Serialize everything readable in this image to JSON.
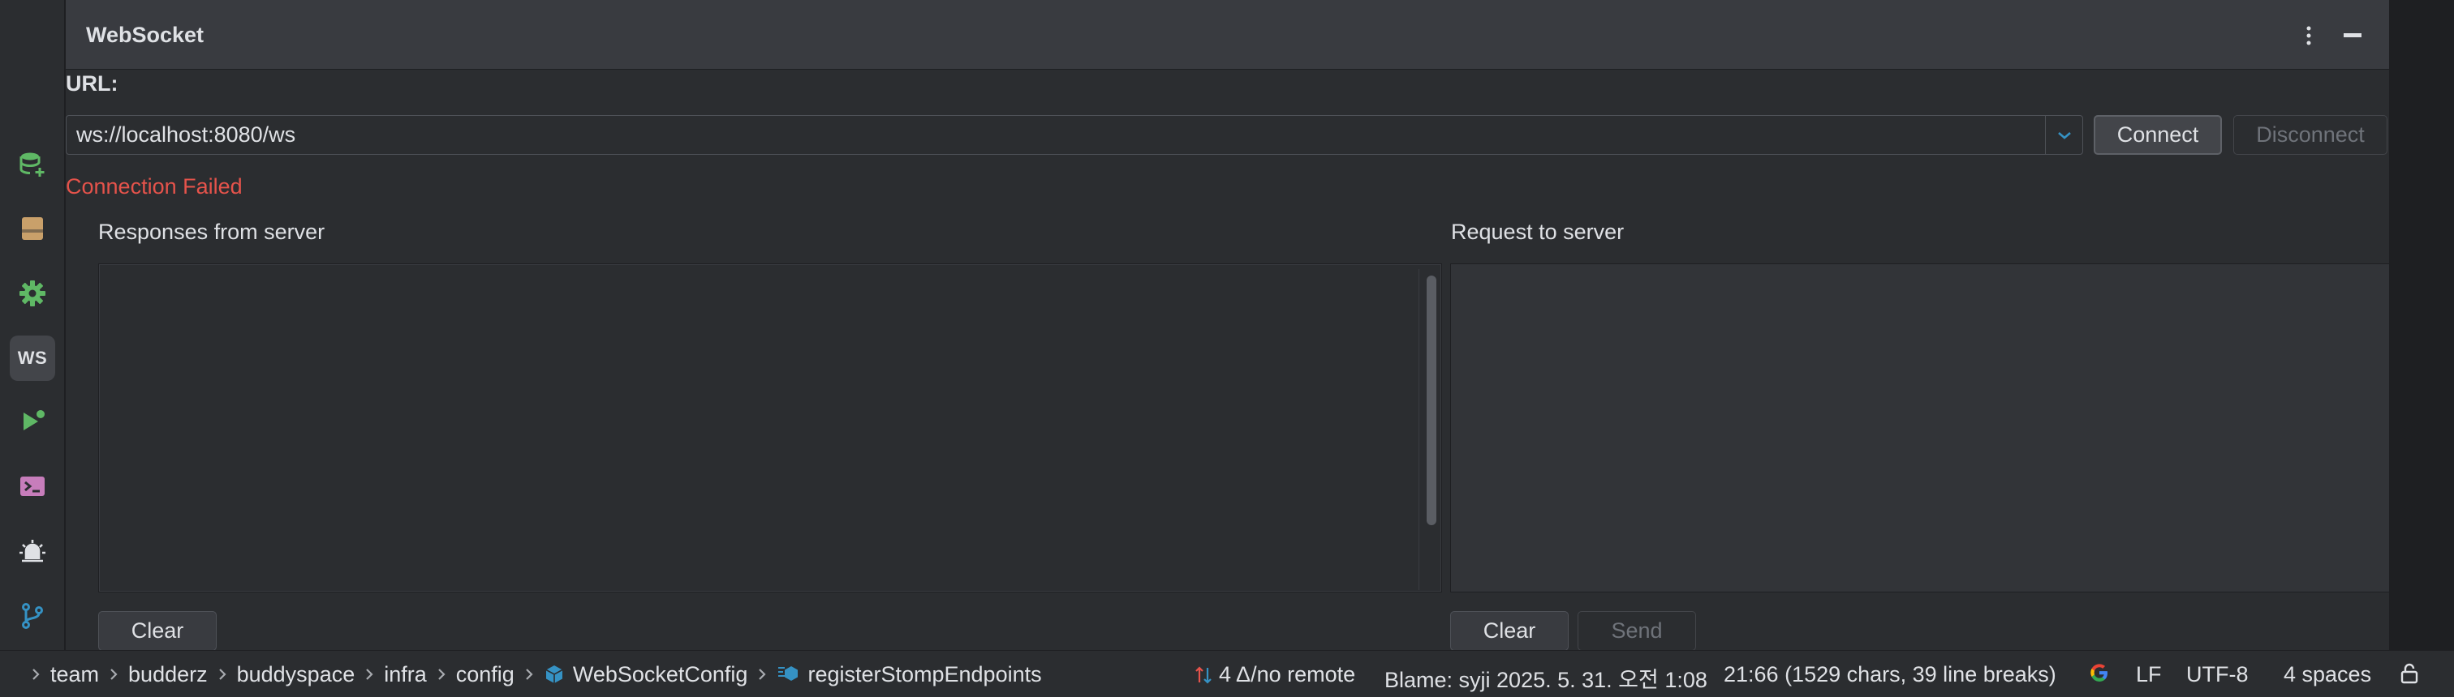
{
  "panel": {
    "title": "WebSocket",
    "url_label": "URL:",
    "url_value": "ws://localhost:8080/ws",
    "connect_label": "Connect",
    "disconnect_label": "Disconnect",
    "status_text": "Connection Failed",
    "responses_label": "Responses from server",
    "request_label": "Request to server",
    "clear_responses_label": "Clear",
    "clear_request_label": "Clear",
    "send_label": "Send"
  },
  "toolstrip": {
    "items": [
      {
        "icon": "database-add-icon"
      },
      {
        "icon": "bookmarks-icon"
      },
      {
        "icon": "services-gear-icon"
      },
      {
        "icon": "websocket-icon",
        "label": "WS"
      },
      {
        "icon": "run-icon"
      },
      {
        "icon": "terminal-icon"
      },
      {
        "icon": "problems-icon"
      },
      {
        "icon": "git-branch-icon"
      }
    ]
  },
  "statusbar": {
    "breadcrumbs": [
      "team",
      "budderz",
      "buddyspace",
      "infra",
      "config",
      "WebSocketConfig",
      "registerStompEndpoints"
    ],
    "vcs": "4 Δ/no remote",
    "blame": "Blame: syji 2025. 5. 31. 오전 1:08",
    "position": "21:66 (1529 chars, 39 line breaks)",
    "line_ending": "LF",
    "encoding": "UTF-8",
    "indent": "4 spaces"
  },
  "colors": {
    "error": "#e5534b",
    "accent": "#3592c4",
    "green": "#5fb865"
  }
}
